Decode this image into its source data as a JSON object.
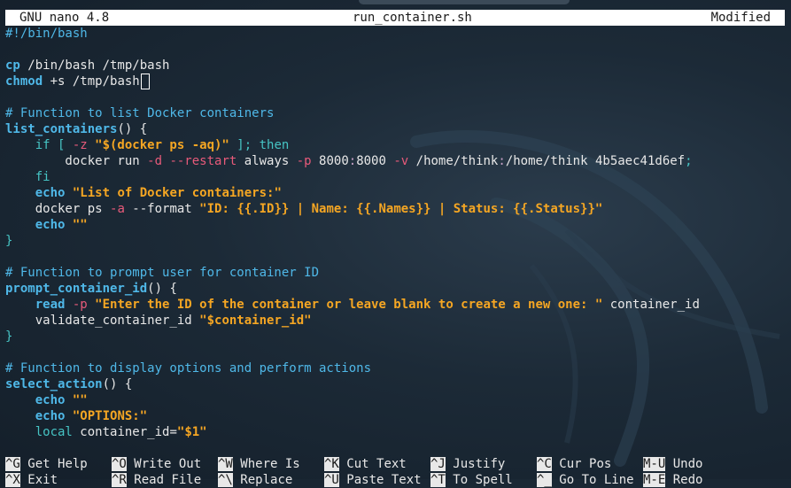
{
  "titlebar": {
    "app": "GNU nano 4.8",
    "filename": "run_container.sh",
    "status": "Modified"
  },
  "code": {
    "l1": "#!/bin/bash",
    "l3_cmd": "cp",
    "l3_rest": " /bin/bash /tmp/bash",
    "l4_cmd": "chmod",
    "l4_rest": " +s /tmp/bash",
    "l6": "# Function to list Docker containers",
    "l7_fn": "list_containers",
    "l7_rest": "() {",
    "l8_a": "    if [ ",
    "l8_flag": "-z",
    "l8_str": " \"$(docker ps -aq)\"",
    "l8_b": " ]; then",
    "l9_a": "        docker run ",
    "l9_f1": "-d",
    "l9_b": " ",
    "l9_f2": "--restart",
    "l9_c": " always ",
    "l9_f3": "-p",
    "l9_d": " 8000",
    "l9_colon": ":",
    "l9_e": "8000 ",
    "l9_f4": "-v",
    "l9_g": " /home/think",
    "l9_colon2": ":",
    "l9_h": "/home/think 4b5aec41d6ef",
    "l9_semi": ";",
    "l10": "    fi",
    "l11_kw": "echo",
    "l11_str": " \"List of Docker containers:\"",
    "l12_a": "    docker ps ",
    "l12_f1": "-a",
    "l12_b": " --format ",
    "l12_str": "\"ID: {{.ID}} | Name: {{.Names}} | Status: {{.Status}}\"",
    "l13_kw": "echo",
    "l13_str": " \"\"",
    "l14": "}",
    "l16": "# Function to prompt user for container ID",
    "l17_fn": "prompt_container_id",
    "l17_rest": "() {",
    "l18_kw": "read",
    "l18_flag": " -p",
    "l18_str": " \"Enter the ID of the container or leave blank to create a new one: \"",
    "l18_rest": " container_id",
    "l19_a": "    validate_container_id ",
    "l19_str": "\"$container_id\"",
    "l20": "}",
    "l22": "# Function to display options and perform actions",
    "l23_fn": "select_action",
    "l23_rest": "() {",
    "l24_kw": "echo",
    "l24_str": " \"\"",
    "l25_kw": "echo",
    "l25_str": " \"OPTIONS:\"",
    "l26_kw": "local",
    "l26_a": " container_id=",
    "l26_str": "\"$1\""
  },
  "shortcuts_row1": [
    {
      "key": "^G",
      "label": "Get Help"
    },
    {
      "key": "^O",
      "label": "Write Out"
    },
    {
      "key": "^W",
      "label": "Where Is"
    },
    {
      "key": "^K",
      "label": "Cut Text"
    },
    {
      "key": "^J",
      "label": "Justify"
    },
    {
      "key": "^C",
      "label": "Cur Pos"
    },
    {
      "key": "M-U",
      "label": "Undo"
    }
  ],
  "shortcuts_row2": [
    {
      "key": "^X",
      "label": "Exit"
    },
    {
      "key": "^R",
      "label": "Read File"
    },
    {
      "key": "^\\",
      "label": "Replace"
    },
    {
      "key": "^U",
      "label": "Paste Text"
    },
    {
      "key": "^T",
      "label": "To Spell"
    },
    {
      "key": "^_",
      "label": "Go To Line"
    },
    {
      "key": "M-E",
      "label": "Redo"
    }
  ],
  "colors": {
    "comment": "#4fb8e8",
    "string": "#f5a623",
    "flag": "#e85a7a",
    "titlebar_bg": "#ffffff"
  }
}
